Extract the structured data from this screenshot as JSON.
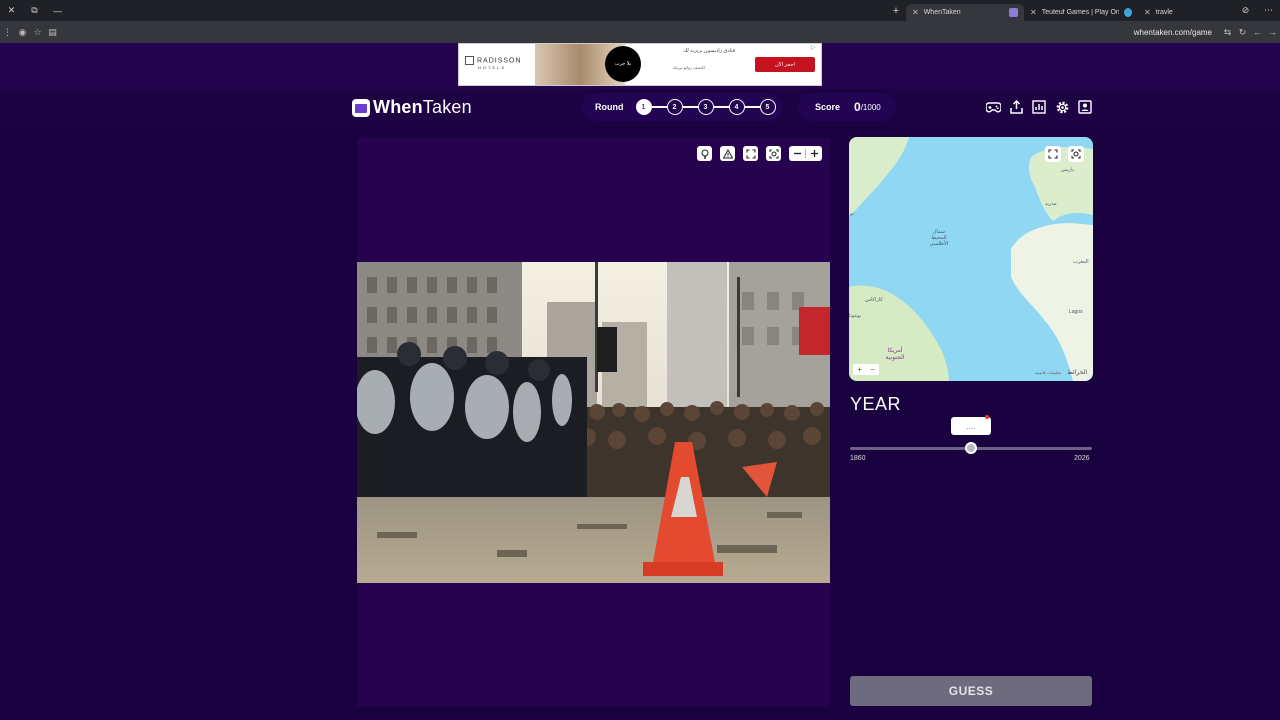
{
  "browser": {
    "tabs": [
      {
        "title": "WhenTaken",
        "active": true
      },
      {
        "title": "Teuteuf Games | Play Online Ga",
        "active": false
      },
      {
        "title": "travle",
        "active": false
      }
    ],
    "url": "whentaken.com/game"
  },
  "ad": {
    "brand": "RADISSON",
    "brand_sub": "HOTELS",
    "headline": "فنادق راديسون بريزنة لك",
    "subline": "اكتشف روائع بيريتك",
    "circle_text": "يلا جرب",
    "cta": "احجز الآن"
  },
  "header": {
    "logo_bold": "When",
    "logo_rest": "Taken",
    "round_label": "Round",
    "rounds": [
      "1",
      "2",
      "3",
      "4",
      "5"
    ],
    "current_round": 1,
    "score_label": "Score",
    "score_value": "0",
    "score_max": "/1000",
    "icons": [
      "gamepad-icon",
      "share-icon",
      "stats-icon",
      "gear-icon",
      "profile-icon"
    ]
  },
  "map": {
    "labels": {
      "paris": "باريس",
      "madrid": "مدريد",
      "north_atlantic": "شمال المحيط الأطلسي",
      "west_edge": "ﺗﻮ",
      "bogota": "بوغوتا",
      "caracas": "كاراكاس",
      "south_america": "أمريكا الجنوبية",
      "lagos": "Lagos",
      "morocco": "المغرب"
    },
    "credit": "الخرائط",
    "legal": "معلومات قانونية"
  },
  "year": {
    "title": "YEAR",
    "placeholder": "....",
    "min": 1860,
    "max": 2026,
    "min_label": "1860",
    "max_label": "2026",
    "value": 1943
  },
  "guess_label": "GUESS",
  "colors": {
    "background": "#1a0240",
    "panel": "#26024f",
    "ocean": "#8fd7f3",
    "land": "#eef3e6",
    "guess_button": "#6d6b7d"
  }
}
